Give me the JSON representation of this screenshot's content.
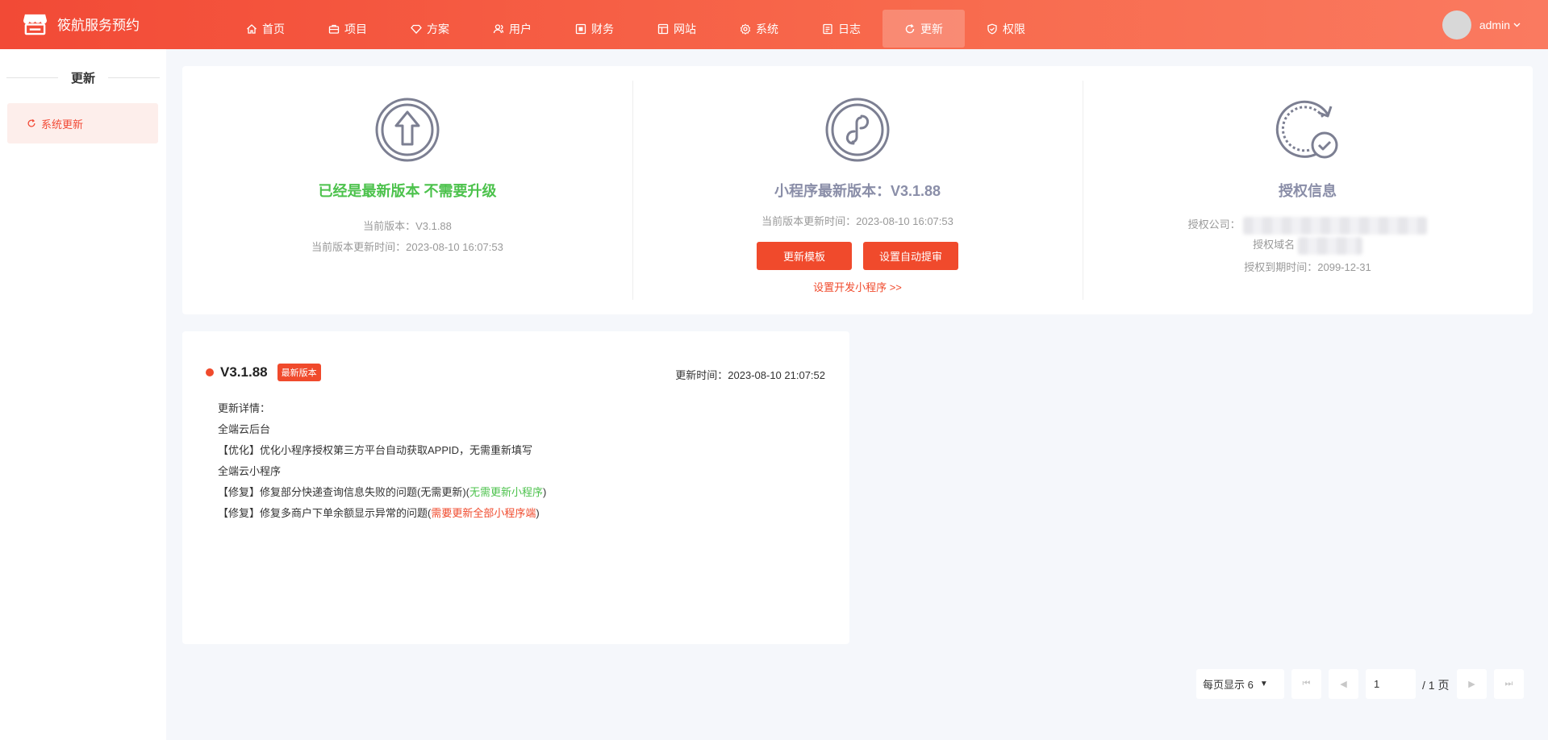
{
  "header": {
    "app_name": "筱航服务预约",
    "nav": [
      {
        "label": "首页",
        "icon": "home-icon"
      },
      {
        "label": "项目",
        "icon": "briefcase-icon"
      },
      {
        "label": "方案",
        "icon": "diamond-icon"
      },
      {
        "label": "用户",
        "icon": "users-icon"
      },
      {
        "label": "财务",
        "icon": "finance-icon"
      },
      {
        "label": "网站",
        "icon": "website-icon"
      },
      {
        "label": "系统",
        "icon": "gear-icon"
      },
      {
        "label": "日志",
        "icon": "log-icon"
      },
      {
        "label": "更新",
        "icon": "refresh-icon",
        "active": true
      },
      {
        "label": "权限",
        "icon": "shield-check-icon"
      }
    ],
    "user": "admin"
  },
  "sidebar": {
    "title": "更新",
    "items": [
      {
        "label": "系统更新",
        "icon": "refresh-icon"
      }
    ]
  },
  "version_panel": {
    "title": "已经是最新版本 不需要升级",
    "current_version": "当前版本：V3.1.88",
    "update_time": "当前版本更新时间：2023-08-10 16:07:53"
  },
  "miniprogram_panel": {
    "title": "小程序最新版本：V3.1.88",
    "update_time": "当前版本更新时间：2023-08-10 16:07:53",
    "btn_update_template": "更新模板",
    "btn_auto_submit": "设置自动提审",
    "dev_link": "设置开发小程序 >>"
  },
  "license_panel": {
    "title": "授权信息",
    "company_label": "授权公司：",
    "domain_label": "授权域名",
    "expiry": "授权到期时间：2099-12-31"
  },
  "update_entry": {
    "version": "V3.1.88",
    "badge": "最新版本",
    "time": "更新时间：2023-08-10 21:07:52",
    "lines": {
      "l0": "更新详情：",
      "l1": "全端云后台",
      "l2": "【优化】优化小程序授权第三方平台自动获取APPID，无需重新填写",
      "l3": "全端云小程序",
      "l4_prefix": "【修复】修复部分快递查询信息失败的问题(无需更新)(",
      "l4_note": "无需更新小程序",
      "l4_suffix": ")",
      "l5_prefix": "【修复】修复多商户下单余额显示异常的问题(",
      "l5_note": "需要更新全部小程序端",
      "l5_suffix": ")"
    }
  },
  "pagination": {
    "per_page": "每页显示 6",
    "current_page": "1",
    "total": "/ 1 页"
  },
  "colors": {
    "accent": "#f04a2c",
    "success": "#4cc24c",
    "muted": "#8a8ea8"
  }
}
